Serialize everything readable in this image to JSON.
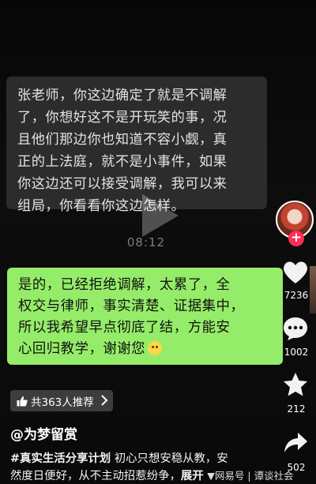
{
  "chat": {
    "incoming_lines": [
      "张老师，你这边确定了就是不调解",
      "了，你想好这不是开玩笑的事，况",
      "且他们那边你也知道不容小觑，真",
      "正的上法庭，就不是小事件，如果",
      "你这边还可以接受调解，我可以来",
      "组局，你看看你这边怎样。"
    ],
    "outgoing_lines": [
      "是的，已经拒绝调解，太累了，全",
      "权交与律师，事实清楚、证据集中，",
      "所以我希望早点彻底了结，方能安",
      "心回归教学，谢谢您"
    ],
    "outgoing_emoji": "smile-emoji-icon"
  },
  "player": {
    "time": "08:12",
    "play_icon": "play-icon"
  },
  "rail": {
    "likes": "7236",
    "comments": "1002",
    "favorites": "212",
    "shares": "502",
    "follow_symbol": "+"
  },
  "post": {
    "recommend": "共363人推荐",
    "author": "@为梦留赏",
    "hashtag": "#真实生活分享计划",
    "desc_line1": "初心只想安稳从教，安",
    "desc_line2": "然度日便好，从不主动招惹纷争，",
    "expand": "展开",
    "watermark": "▼网易号 | 谭谈社会"
  },
  "colors": {
    "incoming_bubble": "#2c2c2c",
    "outgoing_bubble": "#95ec69",
    "follow": "#fe2c55",
    "recommend_pill": "#464646"
  }
}
